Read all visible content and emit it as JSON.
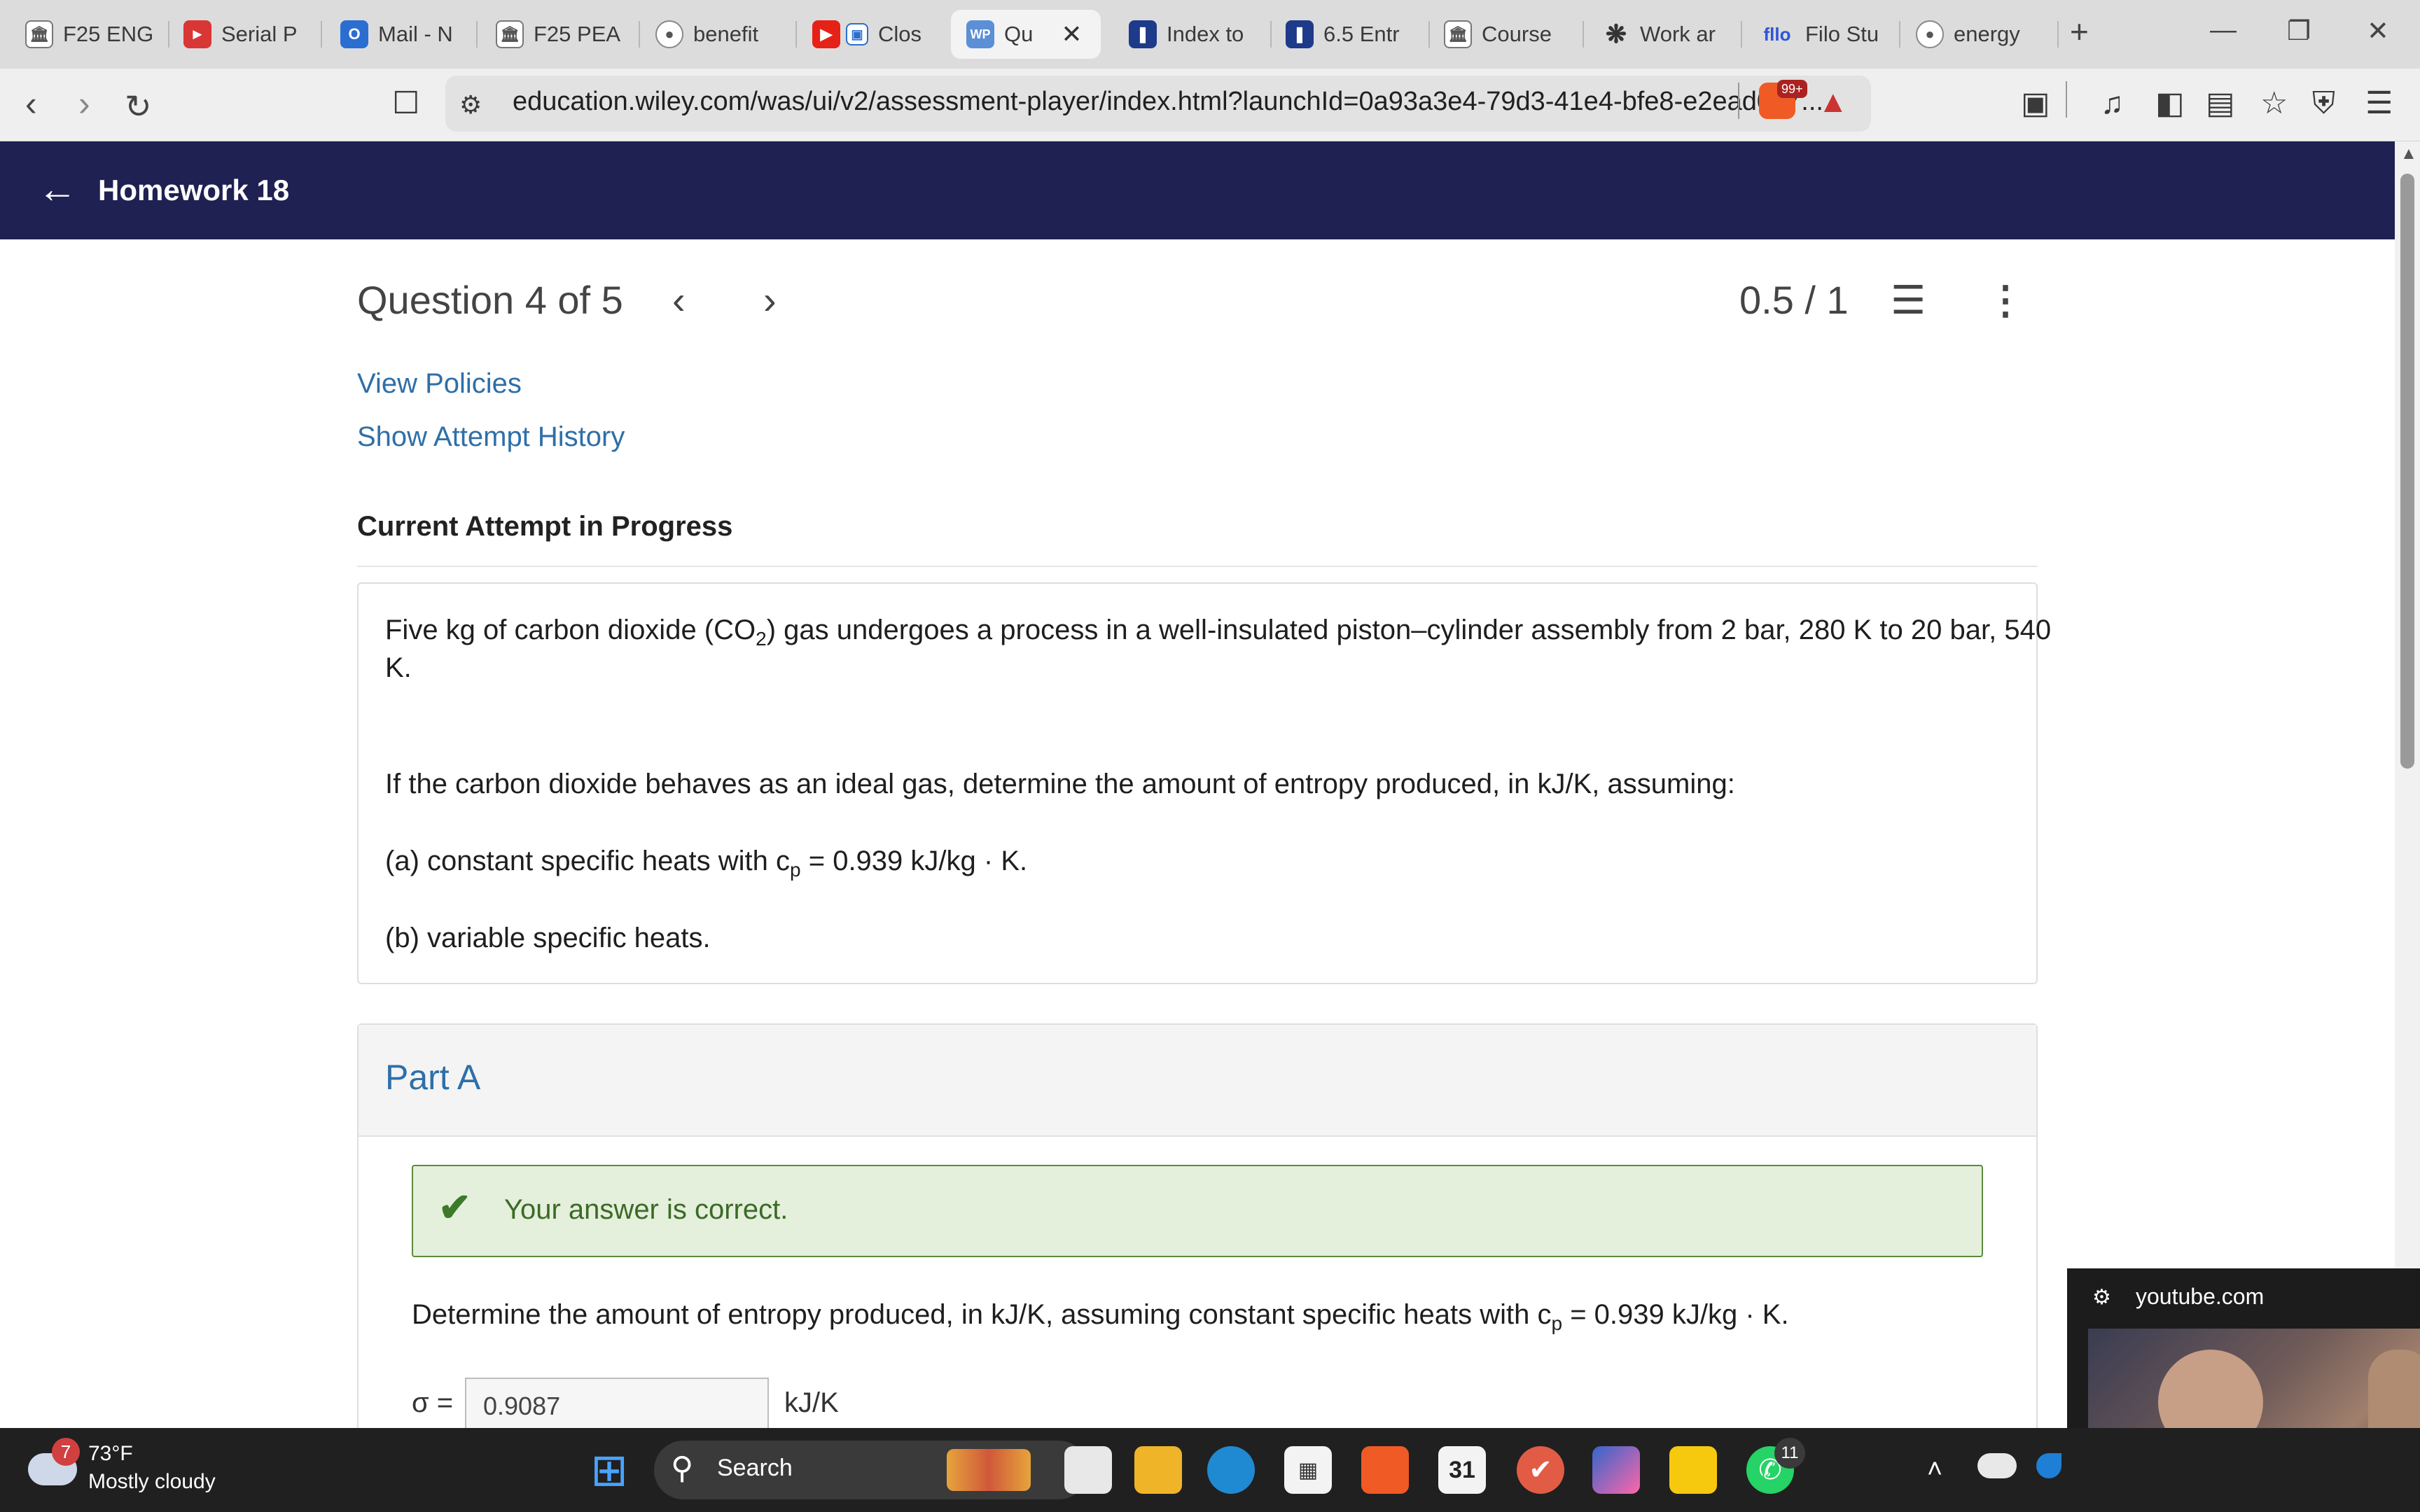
{
  "browser": {
    "tabs": [
      {
        "label": "F25 ENG",
        "icon": "bank-icon",
        "color": "#4c4c4c"
      },
      {
        "label": "Serial P",
        "icon": "red-app-icon",
        "color": "#d93636"
      },
      {
        "label": "Mail - N",
        "icon": "outlook-icon",
        "color": "#2a6ed1"
      },
      {
        "label": "F25 PEA",
        "icon": "bank-icon",
        "color": "#4c4c4c"
      },
      {
        "label": "benefit",
        "icon": "brave-icon",
        "color": "#666666"
      },
      {
        "label": "Clos",
        "icon": "youtube-icon",
        "color": "#e62117"
      },
      {
        "label": "Qu",
        "icon": "wp-icon",
        "color": "#5b8fd6",
        "active": true
      },
      {
        "label": "Index to",
        "icon": "bookmark-icon",
        "color": "#1e3a8a"
      },
      {
        "label": "6.5 Entr",
        "icon": "bookmark-icon",
        "color": "#1e3a8a"
      },
      {
        "label": "Course",
        "icon": "bank-icon",
        "color": "#4c4c4c"
      },
      {
        "label": "Work ar",
        "icon": "openai-icon",
        "color": "#333333"
      },
      {
        "label": "Filo Stu",
        "icon": "filo-icon",
        "color": "#2e56d6"
      },
      {
        "label": "energy",
        "icon": "brave-icon",
        "color": "#666666"
      }
    ],
    "url": "education.wiley.com/was/ui/v2/assessment-player/index.html?launchId=0a93a3e4-79d3-41e4-bfe8-e2ead047...",
    "badge": "99+"
  },
  "header": {
    "title": "Homework 18"
  },
  "question_nav": {
    "label": "Question 4 of 5",
    "score": "0.5 / 1"
  },
  "links": {
    "policies": "View Policies",
    "history": "Show Attempt History"
  },
  "attempt_label": "Current Attempt in Progress",
  "question": {
    "line1": "Five kg of carbon dioxide (CO",
    "sub1": "2",
    "line1b": ") gas undergoes a process in a well-insulated piston–cylinder assembly from 2 bar, 280 K to 20 bar, 540",
    "line1c": "K.",
    "line2": "If the carbon dioxide behaves as an ideal gas, determine the amount of entropy produced, in kJ/K, assuming:",
    "part_a_prefix": "(a) constant specific heats with c",
    "part_a_sub": "p",
    "part_a_suffix": " = 0.939 kJ/kg · K.",
    "part_b": "(b) variable specific heats."
  },
  "part_a": {
    "label": "Part A",
    "feedback": "Your answer is correct.",
    "prompt_prefix": "Determine the amount of entropy produced, in kJ/K, assuming constant specific heats with c",
    "prompt_sub": "p",
    "prompt_suffix": " = 0.939 kJ/kg · K.",
    "sigma_label": "σ =",
    "answer": "0.9087",
    "unit": "kJ/K"
  },
  "pip": {
    "source": "youtube.com"
  },
  "taskbar": {
    "weather_badge": "7",
    "temperature": "73°F",
    "condition": "Mostly cloudy",
    "search_label": "Search",
    "calendar_day": "31",
    "whatsapp_badge": "11"
  }
}
